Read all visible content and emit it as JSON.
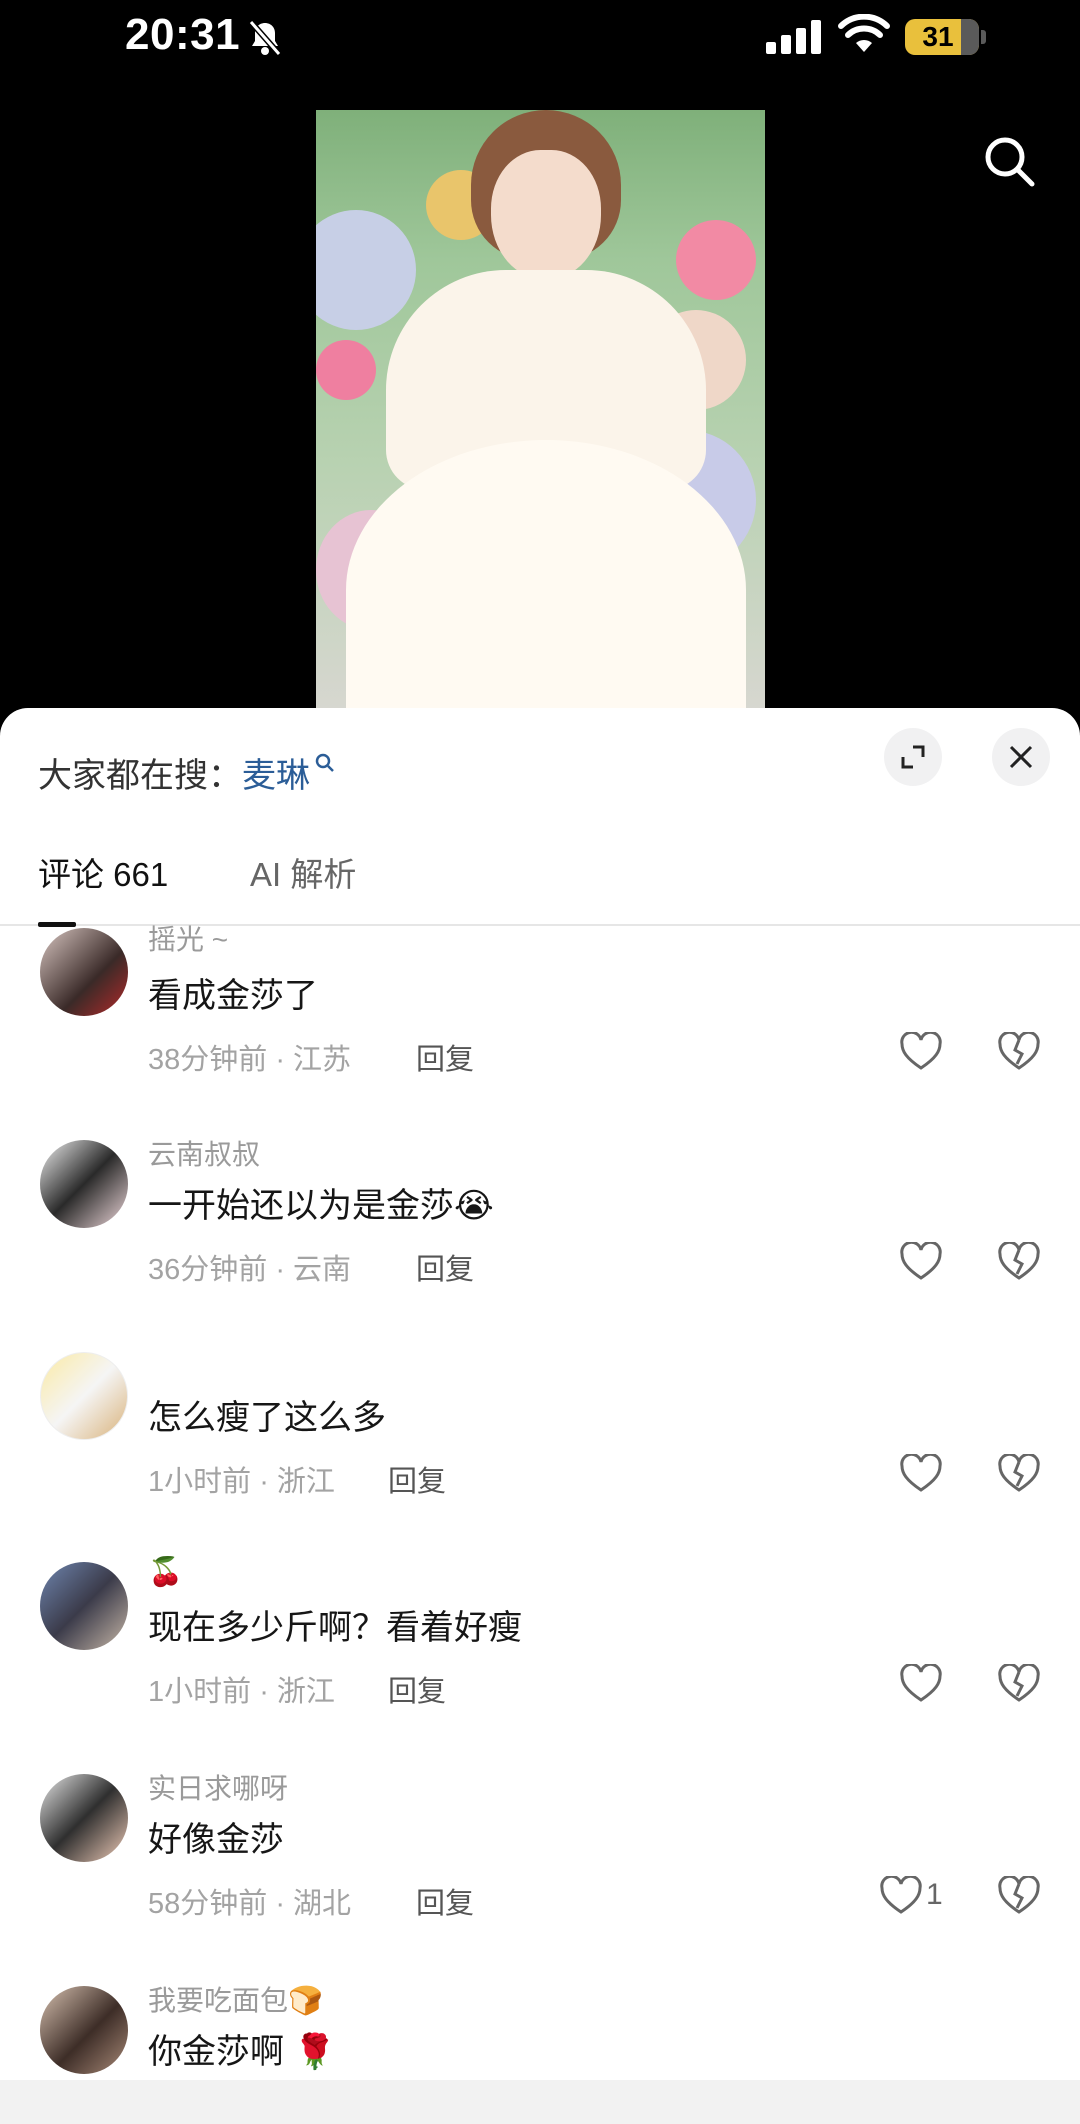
{
  "status_bar": {
    "time": "20:31",
    "battery": "31"
  },
  "trending": {
    "prefix": "大家都在搜：",
    "keyword": "麦琳"
  },
  "tabs": [
    {
      "label": "评论 661"
    },
    {
      "label": "AI 解析"
    }
  ],
  "comments": [
    {
      "username": "摇光 ~",
      "text": "看成金莎了",
      "time": "38分钟前",
      "location": "江苏",
      "reply": "回复",
      "likes": ""
    },
    {
      "username": "云南叔叔",
      "text": "一开始还以为是金莎😭",
      "time": "36分钟前",
      "location": "云南",
      "reply": "回复",
      "likes": ""
    },
    {
      "username": "",
      "text": "怎么瘦了这么多",
      "time": "1小时前",
      "location": "浙江",
      "reply": "回复",
      "likes": ""
    },
    {
      "username": "🍒",
      "text": "现在多少斤啊？看着好瘦",
      "time": "1小时前",
      "location": "浙江",
      "reply": "回复",
      "likes": ""
    },
    {
      "username": "实日求哪呀",
      "text": "好像金莎",
      "time": "58分钟前",
      "location": "湖北",
      "reply": "回复",
      "likes": "1"
    },
    {
      "username": "我要吃面包🍞",
      "text": "你金莎啊 🌹",
      "time": "",
      "location": "",
      "reply": "",
      "likes": ""
    }
  ],
  "separator": " · ",
  "colors": {
    "keyword": "#2b5d97",
    "battery": "#e9c03c"
  }
}
